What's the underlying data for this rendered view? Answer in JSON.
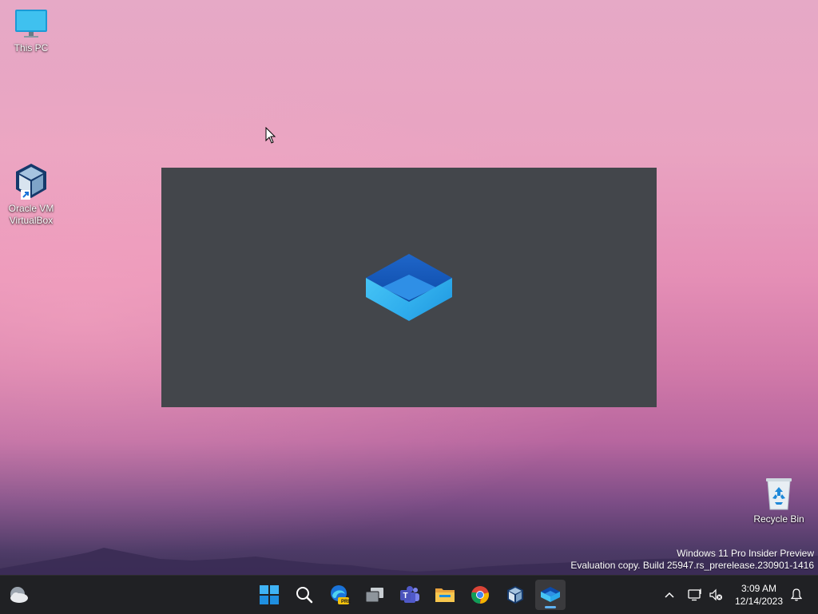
{
  "desktop": {
    "icons": [
      {
        "label": "This PC"
      },
      {
        "label": "Oracle VM VirtualBox"
      },
      {
        "label": "Recycle Bin"
      }
    ]
  },
  "watermark": {
    "line1": "Windows 11 Pro Insider Preview",
    "line2": "Evaluation copy. Build 25947.rs_prerelease.230901-1416"
  },
  "taskbar": {
    "weather_icon": "weather-cloud-icon",
    "apps": [
      {
        "icon": "windows-start-icon"
      },
      {
        "icon": "search-icon"
      },
      {
        "icon": "edge-beta-icon",
        "badge": "PRE"
      },
      {
        "icon": "task-view-icon"
      },
      {
        "icon": "teams-icon"
      },
      {
        "icon": "file-explorer-icon"
      },
      {
        "icon": "chrome-icon"
      },
      {
        "icon": "virtualbox-icon"
      },
      {
        "icon": "sandbox-icon",
        "active": true
      }
    ],
    "tray": {
      "clock_time": "3:09 AM",
      "clock_date": "12/14/2023"
    }
  },
  "colors": {
    "taskbar": "#202124",
    "splash": "#43464b",
    "accent": "#5fb2f2"
  }
}
